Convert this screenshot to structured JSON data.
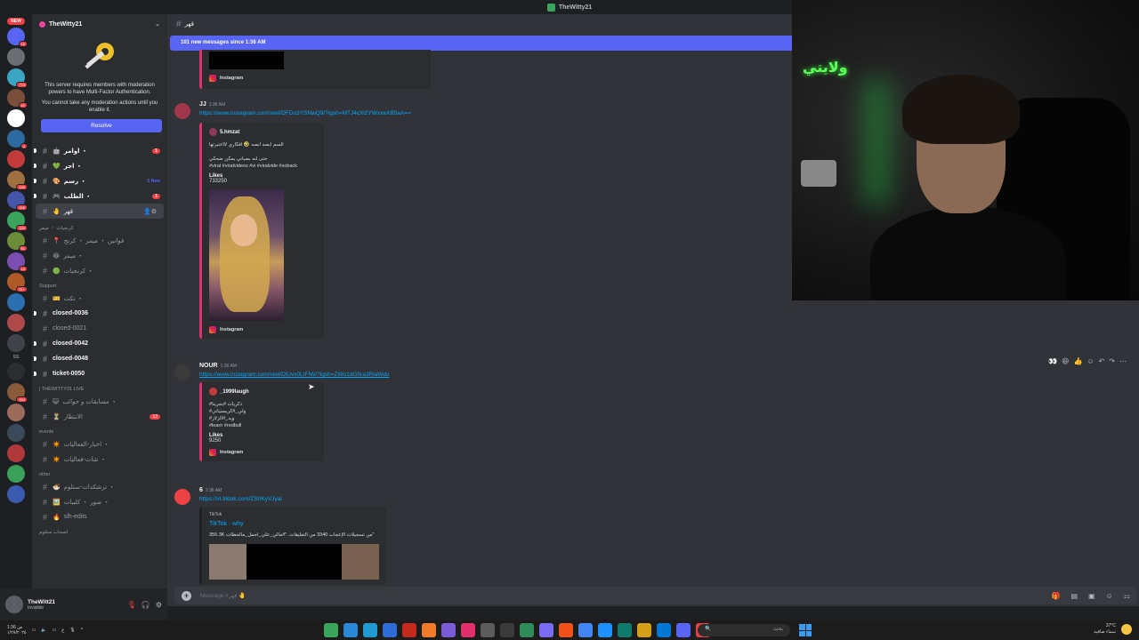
{
  "window": {
    "title": "TheWitty21"
  },
  "rail": {
    "new_label": "NEW",
    "servers": [
      {
        "color": "#5865f2",
        "badge": "16"
      },
      {
        "color": "#6b6e73",
        "badge": ""
      },
      {
        "color": "#3ba5c4",
        "badge": "773"
      },
      {
        "color": "#7a4f3a",
        "badge": "47"
      },
      {
        "color": "#ffffff",
        "badge": ""
      },
      {
        "color": "#2d6a9f",
        "badge": "4"
      },
      {
        "color": "#c43b3b",
        "badge": ""
      },
      {
        "color": "#a07040",
        "badge": "246"
      },
      {
        "color": "#4455aa",
        "badge": "346"
      },
      {
        "color": "#3ba55d",
        "badge": "220"
      },
      {
        "color": "#6d8c3a",
        "badge": "51"
      },
      {
        "color": "#7b4fb0",
        "badge": "14"
      },
      {
        "color": "#b05a2a",
        "badge": "7K+"
      },
      {
        "color": "#2a6fb0",
        "badge": ""
      },
      {
        "color": "#b04a4a",
        "badge": ""
      },
      {
        "color": "#40434a",
        "badge": ""
      },
      {
        "color": "#2b2d31",
        "badge": ""
      },
      {
        "color": "#8a5a3a",
        "badge": "944"
      },
      {
        "color": "#9a6a5a",
        "badge": ""
      },
      {
        "color": "#3a4a5a",
        "badge": ""
      },
      {
        "color": "#b03a3a",
        "badge": ""
      },
      {
        "color": "#3aa05a",
        "badge": ""
      },
      {
        "color": "#3a5ab0",
        "badge": ""
      }
    ],
    "rail_labels": [
      "SS"
    ]
  },
  "sidebar": {
    "guild_name": "TheWitty21",
    "mfa_notice": {
      "line1": "This server requires members with moderation powers to have Multi-Factor Authentication.",
      "line2": "You cannot take any moderation actions until you enable it.",
      "button": "Resolve"
    },
    "channels_top": [
      {
        "name": "اوامر ・",
        "emoji": "🤖",
        "state": "unread",
        "badge": "1"
      },
      {
        "name": "اجر ・",
        "emoji": "💚",
        "state": "unread",
        "badge": ""
      },
      {
        "name": "رسم ・",
        "emoji": "🎨",
        "state": "unread",
        "new": "5 New"
      },
      {
        "name": "الطلب ・",
        "emoji": "🎮",
        "state": "unread",
        "badge": "1"
      },
      {
        "name": "قهر",
        "emoji": "🤚",
        "state": "active",
        "badge": ""
      }
    ],
    "cat_clips": "كرنجيات ・ ميمز",
    "channels_clips": [
      {
        "name": "قوانين ・ ميمز ・ كرنج",
        "emoji": "📍"
      },
      {
        "name": "ميمز ・",
        "emoji": "😂"
      },
      {
        "name": "كرنجيات ・",
        "emoji": "🟢"
      }
    ],
    "cat_support": "Support",
    "channels_support": [
      {
        "name": "تكت ・",
        "emoji": "🎫",
        "state": "muted"
      },
      {
        "name": "closed-0036",
        "state": "unread"
      },
      {
        "name": "closed-0021",
        "state": "muted"
      },
      {
        "name": "closed-0042",
        "state": "unread"
      },
      {
        "name": "closed-0048",
        "state": "unread"
      },
      {
        "name": "ticket-0050",
        "state": "unread"
      }
    ],
    "cat_live": "| THEWITTY21 LIVE",
    "channels_live": [
      {
        "name": "مسابقات و جوائب ・",
        "emoji": "😺"
      },
      {
        "name": "الانتظار",
        "emoji": "⏳",
        "badge": "13"
      }
    ],
    "cat_events": "events",
    "channels_events": [
      {
        "name": "اخبار-الفعاليات ・",
        "emoji": "✴️"
      },
      {
        "name": "شات-فعاليات ・",
        "emoji": "✴️"
      }
    ],
    "cat_other": "other",
    "channels_other": [
      {
        "name": "ترشكدات-ستلوم ・",
        "emoji": "🍜"
      },
      {
        "name": "صور ・ كليبات ・",
        "emoji": "🖼️"
      },
      {
        "name": "slh-edits",
        "emoji": "🔥"
      }
    ],
    "cat_bottom": "اصحاب ستلوم"
  },
  "user": {
    "name": "TheWitt21",
    "status": "Invisible"
  },
  "chat": {
    "channel": "قهر",
    "new_messages": "101 new messages since 1:36 AM",
    "messages": [
      {
        "author": "JJ",
        "time": "1:36 AM",
        "link": "https://www.instagram.com/reel/DFDo3YSNwQ9/?igsh=MTJ4cXl2YWxxeXB5aA==",
        "embed_author": "5.hmzat",
        "embed_text": "السم ابصه ابصه 🤣 افكاري لااعتبرتها\n\nحتى لنه بصباني يمكن ضحكي\n#viral #viralvideos #vi #viralvide #soback",
        "likes_label": "Likes",
        "likes": "733250",
        "footer": "Instagram"
      },
      {
        "author": "NOUR",
        "time": "1:36 AM",
        "link": "https://www.instagram.com/reel/DlUvx0LIFIW/?igsh=ZWo1dG5ra3RlaWdu",
        "embed_author": "_1999laugh",
        "embed_text": "#ذكريات #بحرينا\n#ولي_#كريستياتي\n#ويد_#الزلاز\n#learn #redbull",
        "likes_label": "Likes",
        "likes": "9250",
        "footer": "Instagram"
      },
      {
        "author": "6",
        "time": "1:36 AM",
        "link": "https://vt.tiktok.com/ZShKyVJya/",
        "embed_provider": "TikTok",
        "embed_title": "TikTok · why",
        "embed_desc": "355.3K من تسجيلات الإعجاب 3340 من التعليقات .\"#مالي_علي_اجمل_مالحظات\""
      }
    ],
    "prev_footer": "Instagram"
  },
  "composer": {
    "placeholder": "Message #قهر 🤚"
  },
  "webcam": {
    "neon_text": "ولايتي"
  },
  "taskbar": {
    "search_placeholder": "بحث",
    "temp": "37°C",
    "weather": "سماء صافية",
    "time": "1:36 ص",
    "date": "١/٢٧/٢٠٢٥",
    "lang": "ع"
  },
  "colors": {
    "accent": "#5865f2",
    "link": "#00a8fc",
    "instagram": "#e1306c",
    "danger": "#f23f43"
  }
}
